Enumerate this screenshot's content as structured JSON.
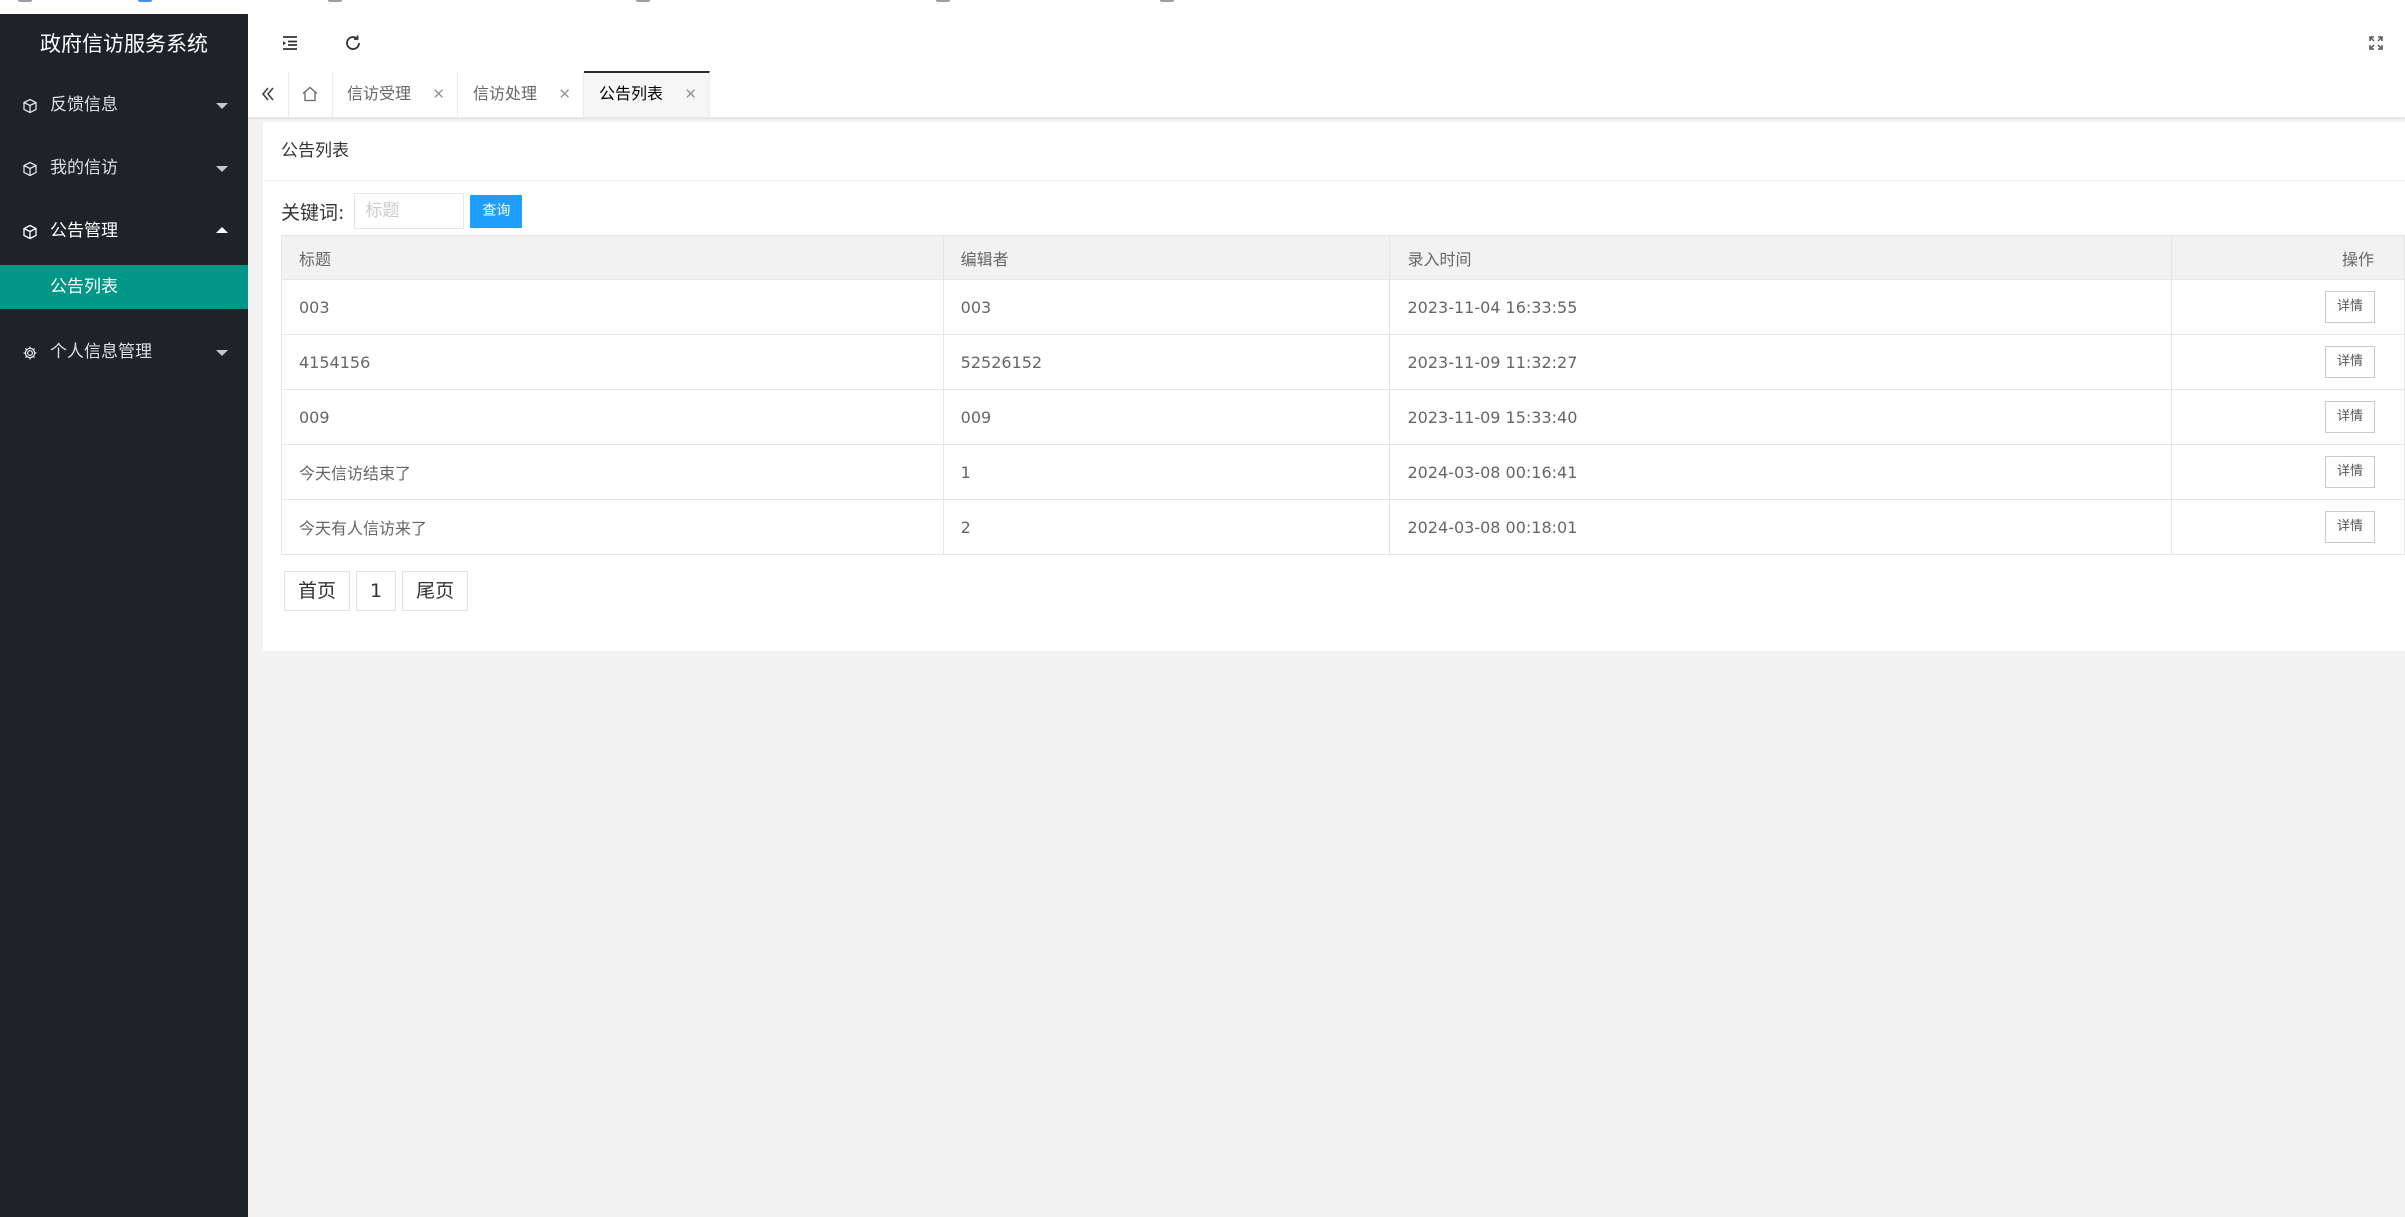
{
  "app": {
    "title": "政府信访服务系统"
  },
  "sidebar": {
    "items": [
      {
        "label": "反馈信息",
        "icon": "cube-icon"
      },
      {
        "label": "我的信访",
        "icon": "cube-icon"
      },
      {
        "label": "公告管理",
        "icon": "cube-icon",
        "open": true,
        "children": [
          {
            "label": "公告列表",
            "active": true
          }
        ]
      },
      {
        "label": "个人信息管理",
        "icon": "gear-icon"
      }
    ]
  },
  "tabs": [
    {
      "label": "信访受理"
    },
    {
      "label": "信访处理"
    },
    {
      "label": "公告列表",
      "active": true
    }
  ],
  "page": {
    "title": "公告列表",
    "search": {
      "label": "关键词:",
      "placeholder": "标题",
      "value": "",
      "button": "查询"
    },
    "table": {
      "columns": [
        "标题",
        "编辑者",
        "录入时间",
        "操作"
      ],
      "rows": [
        {
          "title": "003",
          "editor": "003",
          "time": "2023-11-04 16:33:55",
          "action": "详情"
        },
        {
          "title": "4154156",
          "editor": "52526152",
          "time": "2023-11-09 11:32:27",
          "action": "详情"
        },
        {
          "title": "009",
          "editor": "009",
          "time": "2023-11-09 15:33:40",
          "action": "详情"
        },
        {
          "title": "今天信访结束了",
          "editor": "1",
          "time": "2024-03-08 00:16:41",
          "action": "详情"
        },
        {
          "title": "今天有人信访来了",
          "editor": "2",
          "time": "2024-03-08 00:18:01",
          "action": "详情"
        }
      ]
    },
    "pager": {
      "first": "首页",
      "current": "1",
      "last": "尾页"
    }
  },
  "colors": {
    "sidebar_bg": "#20222a",
    "active_green": "#009688",
    "primary_blue": "#1e9fff"
  }
}
